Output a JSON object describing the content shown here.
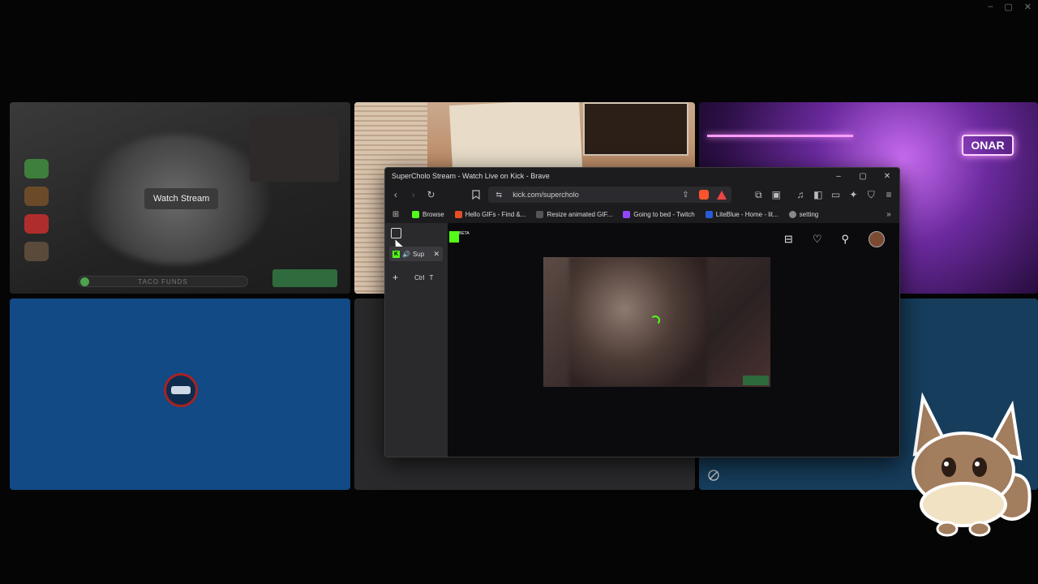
{
  "outer_window": {
    "controls": [
      "–",
      "▢",
      "✕"
    ]
  },
  "tiles": {
    "tile1": {
      "button_label": "Watch Stream",
      "bar_label": "TACO FUNDS"
    },
    "tile3": {
      "sign_text": "ONAR"
    }
  },
  "browser": {
    "title": "SuperCholo Stream - Watch Live on Kick - Brave",
    "window_controls": [
      "–",
      "▢",
      "✕"
    ],
    "url": "kick.com/supercholo",
    "bookmarks": [
      {
        "label": "Browse",
        "color": "#53fc18"
      },
      {
        "label": "Hello GIFs - Find &...",
        "color": "#e44d26"
      },
      {
        "label": "Resize animated GIF...",
        "color": "#555555"
      },
      {
        "label": "Going to bed - Twitch",
        "color": "#9146ff"
      },
      {
        "label": "LiteBlue - Home - lit...",
        "color": "#2a5bd7"
      },
      {
        "label": "setting",
        "color": "#888888"
      }
    ],
    "sidebar": {
      "tab_label": "Sup",
      "new_tab_shortcut": [
        "Ctrl",
        "T"
      ]
    },
    "page": {
      "logo_badge": "BETA",
      "icons": [
        "library-icon",
        "heart-icon",
        "search-icon",
        "avatar"
      ]
    }
  }
}
